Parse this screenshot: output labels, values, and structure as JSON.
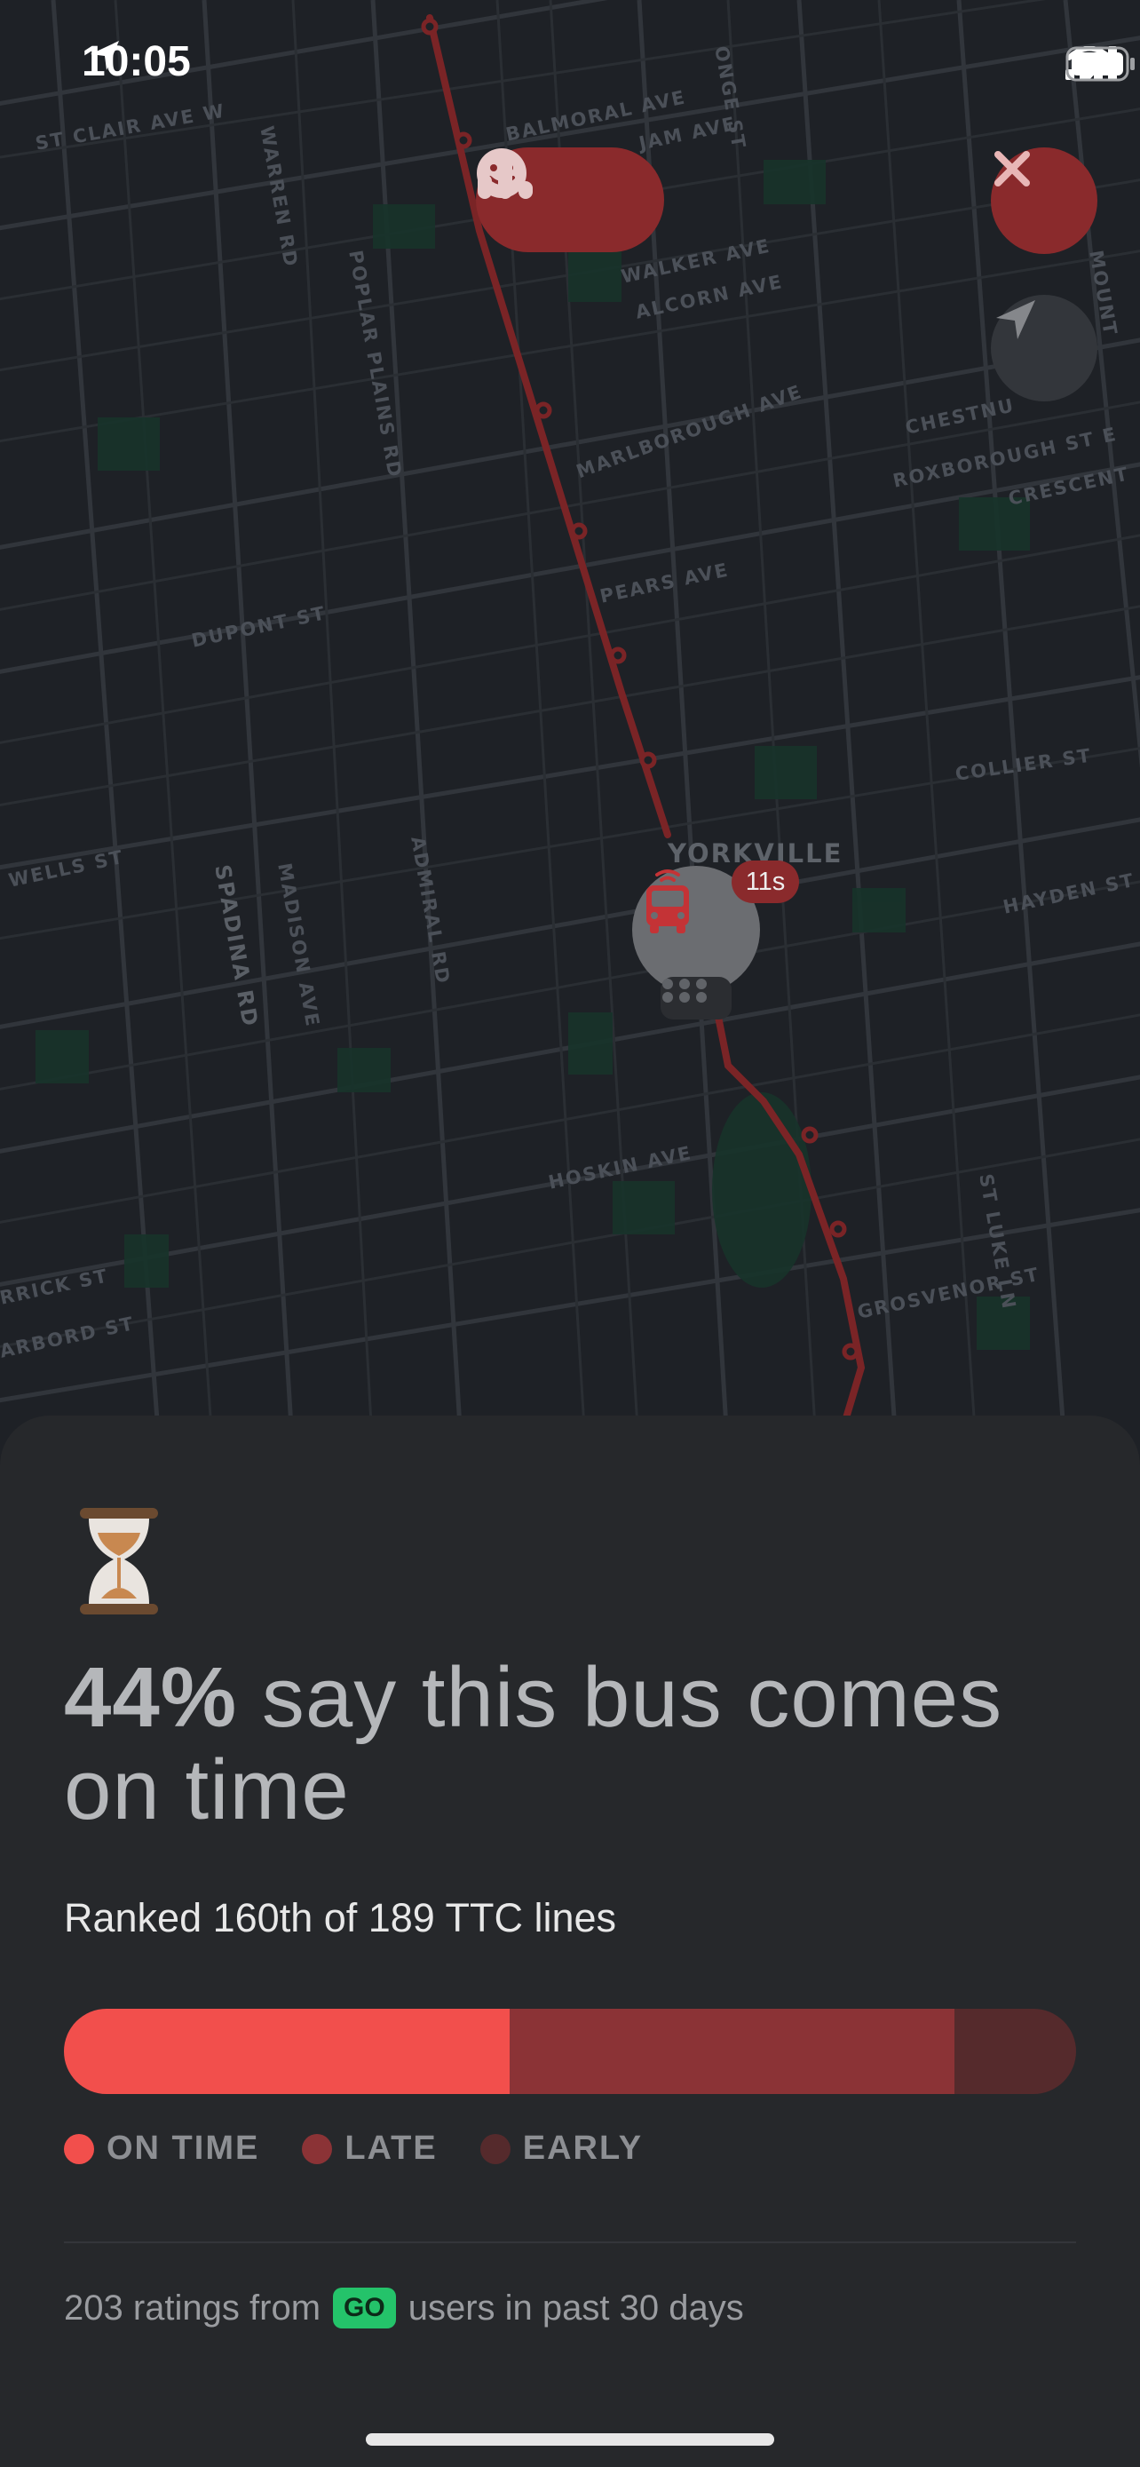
{
  "status_bar": {
    "time": "10:05",
    "icons": [
      "location-arrow-icon",
      "signal-icon",
      "wifi-icon",
      "battery-icon"
    ]
  },
  "map": {
    "streets": [
      "ST CLAIR AVE W",
      "WARREN RD",
      "BALMORAL AVE",
      "JAM AVE",
      "ONGE ST",
      "POPLAR PLAINS RD",
      "WALKER AVE",
      "ALCORN AVE",
      "MARLBOROUGH AVE",
      "CHESTNU",
      "ROXBOROUGH ST E",
      "CRESCENT",
      "PEARS AVE",
      "DUPONT ST",
      "SPADINA RD",
      "MADISON AVE",
      "ADMIRAL RD",
      "COLLIER ST",
      "WELLS ST",
      "YORKVILLE",
      "HAYDEN ST",
      "HOSKIN AVE",
      "ST LUKE LN",
      "GROSVENOR ST",
      "RRICK ST",
      "ARBORD ST",
      "MOUNT"
    ],
    "bus_badge": "11s",
    "route_color": "#8a2a2c"
  },
  "headline": {
    "percent": "44%",
    "text": " say this bus comes on time"
  },
  "rank_text": "Ranked 160th of 189 TTC lines",
  "breakdown": {
    "on_time": {
      "fraction": 0.44,
      "color": "#f24f4c"
    },
    "late": {
      "fraction": 0.44,
      "color": "#8b3336"
    },
    "early": {
      "fraction": 0.12,
      "color": "#552a2c"
    }
  },
  "legend": [
    "ON TIME",
    "LATE",
    "EARLY"
  ],
  "footer": {
    "prefix": "203 ratings from",
    "badge": "GO",
    "suffix": "users in past 30 days"
  }
}
